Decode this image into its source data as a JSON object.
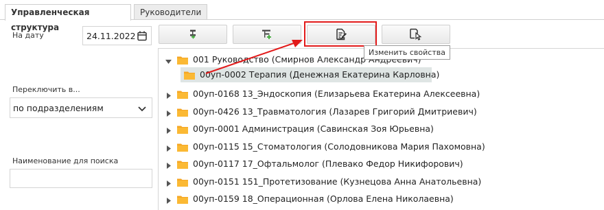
{
  "tabs": [
    {
      "label": "Управленческая структура",
      "active": true
    },
    {
      "label": "Руководители",
      "active": false
    }
  ],
  "filters": {
    "date_label": "На дату",
    "date_value": "24.11.2022",
    "switch_label": "Переключить в...",
    "switch_value": "по подразделениям",
    "search_label": "Наименование для поиска",
    "search_value": ""
  },
  "toolbar": {
    "buttons": [
      {
        "name": "add-child-button",
        "icon": "add-subitem-icon"
      },
      {
        "name": "add-sibling-button",
        "icon": "add-tree-node-icon"
      },
      {
        "name": "edit-properties-button",
        "icon": "edit-document-icon"
      },
      {
        "name": "select-item-button",
        "icon": "select-document-icon"
      }
    ],
    "tooltip": "Изменить свойства"
  },
  "tree": {
    "items": [
      {
        "text": "001 Руководство (Смирнов Александр Андреевич)",
        "level": 0,
        "expanded": true,
        "selected": false
      },
      {
        "text": "00уп-0002 Терапия (Денежная Екатерина Карловна)",
        "level": 1,
        "expanded": false,
        "selected": true
      },
      {
        "text": "00уп-0168 13_Эндоскопия (Елизарьева Екатерина Алексеевна)",
        "level": 0,
        "expanded": false,
        "selected": false
      },
      {
        "text": "00уп-0426 13_Травматология (Лазарев Григорий Дмитриевич)",
        "level": 0,
        "expanded": false,
        "selected": false
      },
      {
        "text": "00уп-0001 Администрация (Савинская Зоя Юрьевна)",
        "level": 0,
        "expanded": false,
        "selected": false
      },
      {
        "text": "00уп-0115 15_Стоматология (Солодовникова Мария Пахомовна)",
        "level": 0,
        "expanded": false,
        "selected": false
      },
      {
        "text": "00уп-0117 17_Офтальмолог (Плевако Федор Никифорович)",
        "level": 0,
        "expanded": false,
        "selected": false
      },
      {
        "text": "00уп-0151 151_Протетизование (Кузнецова Анна Анатольевна)",
        "level": 0,
        "expanded": false,
        "selected": false
      },
      {
        "text": "00уп-0159 18_Операционная (Орлова Елена Николаевна)",
        "level": 0,
        "expanded": false,
        "selected": false
      }
    ]
  },
  "colors": {
    "accent_red": "#e21a1a",
    "folder": "#f5a623",
    "icon_green": "#3aa935",
    "selection": "#dfe5e4"
  }
}
